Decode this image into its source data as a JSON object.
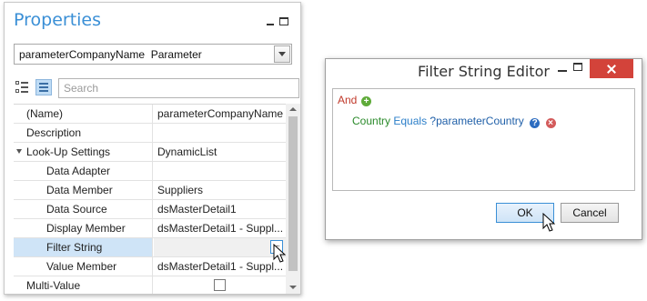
{
  "properties": {
    "title": "Properties",
    "combo_value": "parameterCompanyName  Parameter",
    "search_placeholder": "Search",
    "rows": [
      {
        "name": "(Name)",
        "value": "parameterCompanyName",
        "indent": 0
      },
      {
        "name": "Description",
        "value": "",
        "indent": 0
      },
      {
        "name": "Look-Up Settings",
        "value": "DynamicList",
        "indent": 0,
        "expander": true
      },
      {
        "name": "Data Adapter",
        "value": "",
        "indent": 1
      },
      {
        "name": "Data Member",
        "value": "Suppliers",
        "indent": 1
      },
      {
        "name": "Data Source",
        "value": "dsMasterDetail1",
        "indent": 1
      },
      {
        "name": "Display Member",
        "value": "dsMasterDetail1 - Suppl...",
        "indent": 1
      },
      {
        "name": "Filter String",
        "value": "",
        "indent": 1,
        "selected": true,
        "ellipsis": "..."
      },
      {
        "name": "Value Member",
        "value": "dsMasterDetail1 - Suppl...",
        "indent": 1
      },
      {
        "name": "Multi-Value",
        "value": "",
        "indent": 0,
        "checkbox": true
      }
    ]
  },
  "filter_editor": {
    "title": "Filter String Editor",
    "group_operator": "And",
    "condition": {
      "field": "Country",
      "operator": "Equals",
      "value": "?parameterCountry"
    },
    "ok_label": "OK",
    "cancel_label": "Cancel"
  },
  "colors": {
    "accent": "#3a8fd6",
    "close_button": "#d3433a",
    "and_keyword": "#c0392b",
    "field": "#2a8a2a",
    "operator": "#2c7fc9",
    "selected_row": "#cfe4f7"
  }
}
